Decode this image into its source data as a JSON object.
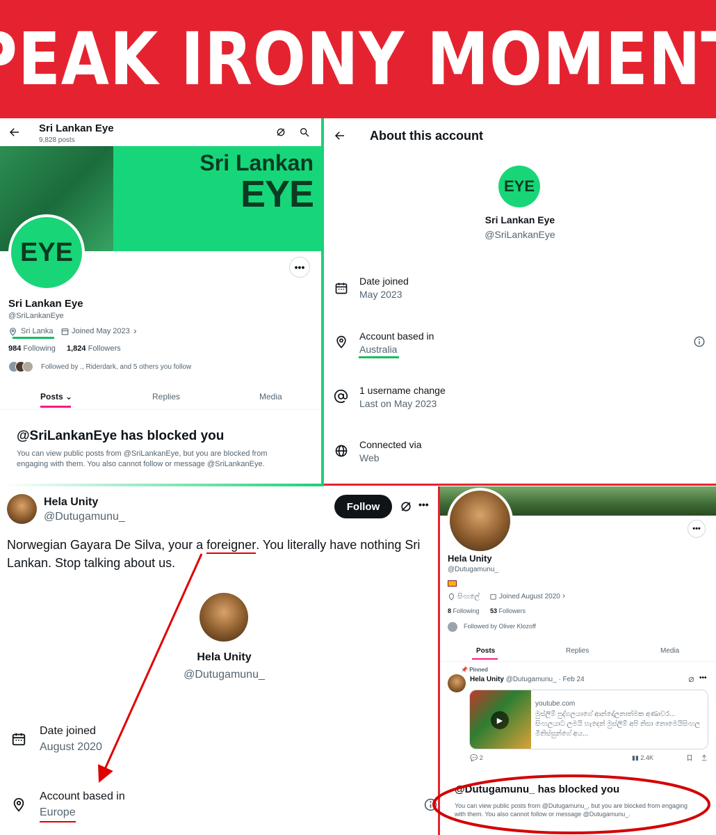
{
  "banner": {
    "title": "PEAK IRONY MOMENT"
  },
  "profile_panel": {
    "header_name": "Sri Lankan Eye",
    "post_count": "9,828 posts",
    "cover_line1": "Sri Lankan",
    "cover_line2": "EYE",
    "avatar_text": "EYE",
    "display_name": "Sri Lankan Eye",
    "handle": "@SriLankanEye",
    "location": "Sri Lanka",
    "joined": "Joined May 2023",
    "following_count": "984",
    "following_label": "Following",
    "followers_count": "1,824",
    "followers_label": "Followers",
    "followed_by": "Followed by ., Riderdark, and 5 others you follow",
    "tabs": [
      "Posts",
      "Replies",
      "Media"
    ],
    "blocked_title": "@SriLankanEye has blocked you",
    "blocked_text": "You can view public posts from @SriLankanEye, but you are blocked from engaging with them. You also cannot follow or message @SriLankanEye.",
    "colors": {
      "brand_green": "#17d67a",
      "active_tab_underline": "#f91880"
    }
  },
  "about_panel": {
    "title": "About this account",
    "avatar_text": "EYE",
    "name": "Sri Lankan Eye",
    "handle": "@SriLankanEye",
    "rows": [
      {
        "icon": "calendar-icon",
        "label": "Date joined",
        "value": "May 2023"
      },
      {
        "icon": "location-pin-icon",
        "label": "Account based in",
        "value": "Australia"
      },
      {
        "icon": "at-sign-icon",
        "label": "1 username change",
        "value": "Last on May 2023"
      },
      {
        "icon": "globe-icon",
        "label": "Connected via",
        "value": "Web"
      }
    ]
  },
  "tweet_panel": {
    "name": "Hela Unity",
    "handle": "@Dutugamunu_",
    "follow_label": "Follow",
    "tweet_text_before": "Norwegian Gayara De Silva, your a ",
    "tweet_text_highlight": "foreigner",
    "tweet_text_after": ". You literally have nothing Sri Lankan. Stop talking about us.",
    "about_name": "Hela Unity",
    "about_handle": "@Dutugamunu_",
    "date_joined_label": "Date joined",
    "date_joined_value": "August 2020",
    "based_label": "Account based in",
    "based_value": "Europe"
  },
  "hela_profile_panel": {
    "display_name": "Hela Unity",
    "handle": "@Dutugamunu_",
    "location": "සිංහලේ",
    "joined": "Joined August 2020",
    "following_count": "8",
    "following_label": "Following",
    "followers_count": "53",
    "followers_label": "Followers",
    "followed_by": "Followed by Oliver Klozoff",
    "tabs": [
      "Posts",
      "Replies",
      "Media"
    ],
    "pinned_label": "Pinned",
    "post_author": "Hela Unity",
    "post_meta": "@Dutugamunu_ · Feb 24",
    "card_domain": "youtube.com",
    "card_text": "මුස්ලිම් පුද්ගලයාගේ ආන්දෝලනාත්මක අණාවර... සිංහලයාට ලමයි හැදෙන් මුස්ලිම් අපි නිසා නොමෙයිසිංහල මිනිස්සුන්ගේ අය...",
    "stat_replies": "2",
    "stat_views": "2.4K",
    "blocked_title": "@Dutugamunu_ has blocked you",
    "blocked_text": "You can view public posts from @Dutugamunu_, but you are blocked from engaging with them. You also cannot follow or message @Dutugamunu_."
  }
}
